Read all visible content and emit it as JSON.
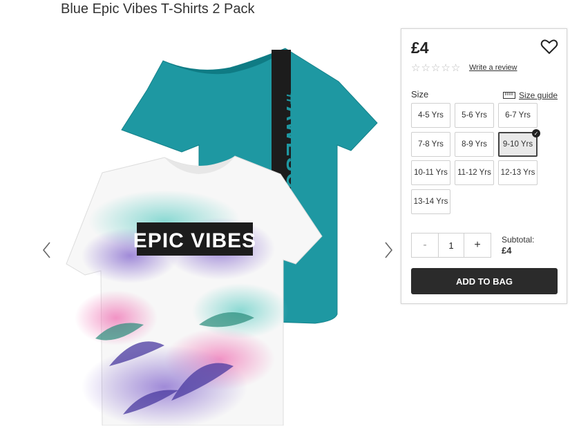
{
  "product": {
    "title": "Blue Epic Vibes T-Shirts 2 Pack",
    "price": "£4",
    "rating_stars": 0,
    "write_review": "Write a review"
  },
  "gallery": {
    "front_shirt_text": "EPIC VIBES",
    "back_shirt_text": "#AWESOME",
    "colors": {
      "teal_shirt": "#1f9aa4",
      "white_shirt": "#f6f6f6",
      "print_black": "#1c1c1c"
    }
  },
  "size": {
    "label": "Size",
    "guide_label": "Size guide",
    "options": [
      "4-5 Yrs",
      "5-6 Yrs",
      "6-7 Yrs",
      "7-8 Yrs",
      "8-9 Yrs",
      "9-10 Yrs",
      "10-11 Yrs",
      "11-12 Yrs",
      "12-13 Yrs",
      "13-14 Yrs"
    ],
    "selected": "9-10 Yrs"
  },
  "quantity": {
    "minus": "-",
    "value": "1",
    "plus": "+"
  },
  "subtotal": {
    "label": "Subtotal:",
    "amount": "£4"
  },
  "add_to_bag": "ADD TO BAG"
}
